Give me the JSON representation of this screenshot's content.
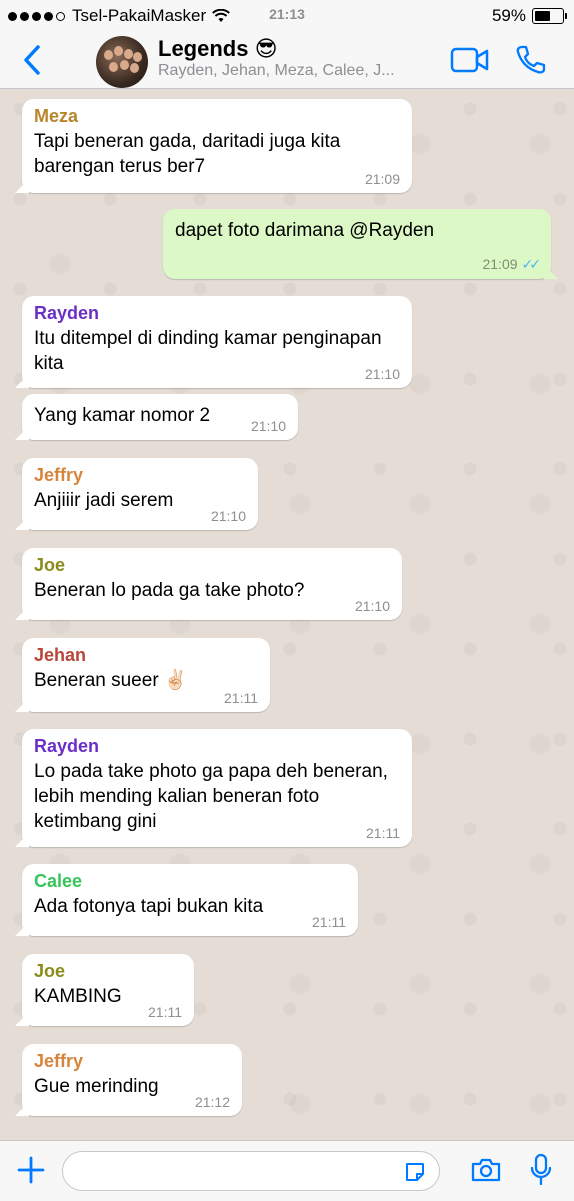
{
  "status_bar": {
    "carrier": "Tsel-PakaiMasker",
    "time": "21:13",
    "battery": "59%",
    "battery_level": 0.59
  },
  "header": {
    "title": "Legends 😎",
    "subtitle": "Rayden, Jehan, Meza, Calee, J...",
    "accent_color": "#007aff"
  },
  "colors": {
    "Meza": "#b9852b",
    "Rayden": "#6b2fc8",
    "Jeffry": "#d7853d",
    "Joe": "#8a8b1a",
    "Jehan": "#b8463a",
    "Calee": "#37c45b",
    "outgoing_bubble": "#dcf8c6",
    "read_ticks": "#4fb6ec"
  },
  "messages": [
    {
      "sender": "Meza",
      "text": "Tapi beneran gada, daritadi juga kita barengan terus ber7",
      "time": "21:09"
    },
    {
      "text": "dapet foto darimana @Rayden",
      "time": "21:09",
      "outgoing": true,
      "ticks": "✓✓"
    },
    {
      "sender": "Rayden",
      "text": "Itu ditempel di dinding kamar penginapan kita",
      "time": "21:10"
    },
    {
      "text": "Yang kamar nomor 2",
      "time": "21:10"
    },
    {
      "sender": "Jeffry",
      "text": "Anjiiir jadi serem",
      "time": "21:10"
    },
    {
      "sender": "Joe",
      "text": "Beneran lo pada ga take photo?",
      "time": "21:10"
    },
    {
      "sender": "Jehan",
      "text": "Beneran sueer ✌🏻",
      "time": "21:11"
    },
    {
      "sender": "Rayden",
      "text": "Lo pada take photo ga papa deh beneran, lebih mending kalian beneran foto ketimbang gini",
      "time": "21:11"
    },
    {
      "sender": "Calee",
      "text": "Ada fotonya tapi bukan kita",
      "time": "21:11"
    },
    {
      "sender": "Joe",
      "text": "KAMBING",
      "time": "21:11"
    },
    {
      "sender": "Jeffry",
      "text": "Gue merinding",
      "time": "21:12"
    }
  ],
  "input": {
    "value": "",
    "icons": [
      "plus-icon",
      "sticker-icon",
      "camera-icon",
      "mic-icon"
    ]
  }
}
